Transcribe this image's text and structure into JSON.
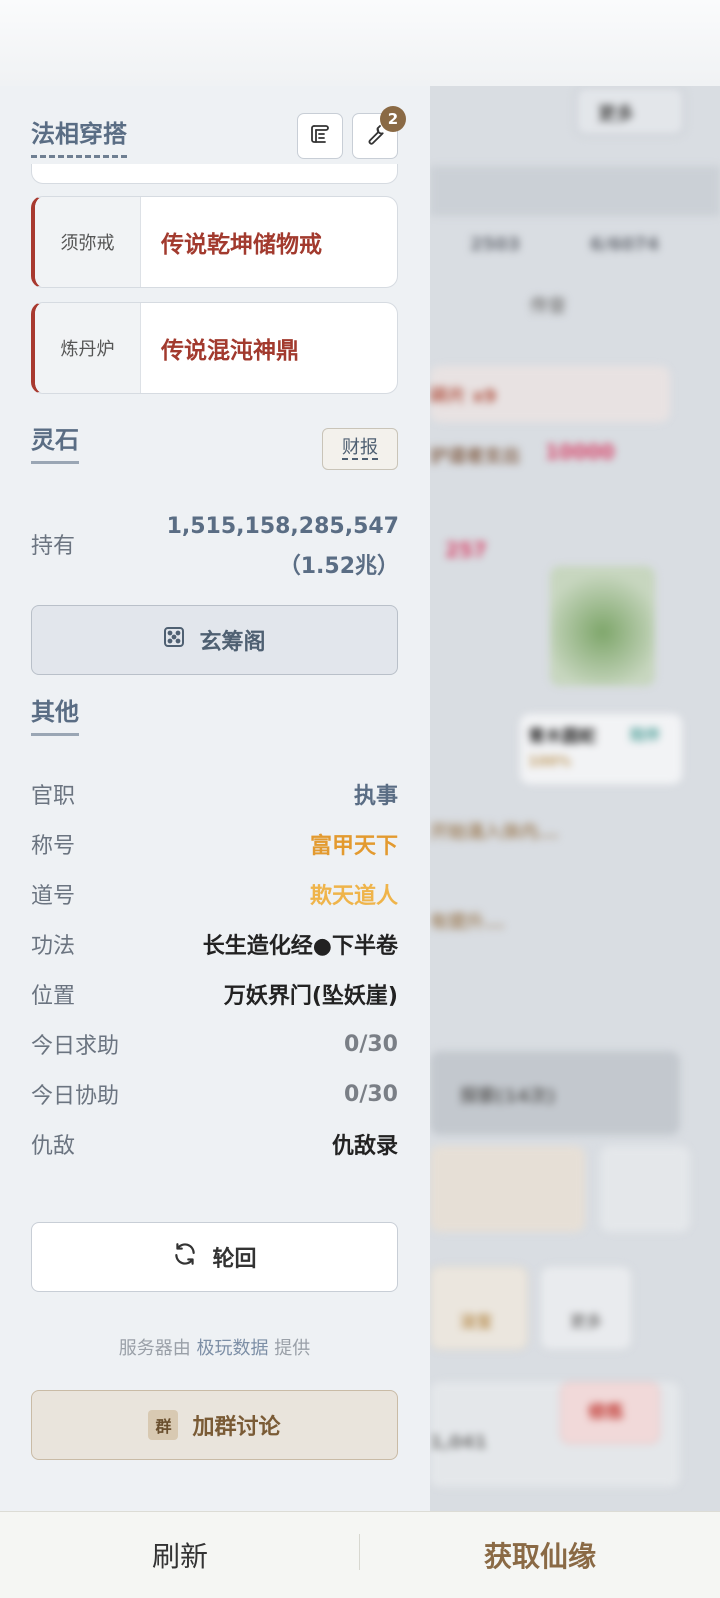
{
  "drawer": {
    "outfit_title": "法相穿搭",
    "badge_count": "2",
    "equipment": [
      {
        "slot": "须弥戒",
        "item": "传说乾坤储物戒"
      },
      {
        "slot": "炼丹炉",
        "item": "传说混沌神鼎"
      }
    ],
    "spirit_stone": {
      "title": "灵石",
      "report_label": "财报",
      "hold_label": "持有",
      "hold_value": "1,515,158,285,547",
      "hold_short": "（1.52兆）",
      "pavilion_label": "玄筹阁"
    },
    "other": {
      "title": "其他",
      "rows": [
        {
          "key": "官职",
          "value": "执事",
          "color": "#5a6d84"
        },
        {
          "key": "称号",
          "value": "富甲天下",
          "color": "#e39a2f"
        },
        {
          "key": "道号",
          "value": "欺天道人",
          "color": "#efb44a"
        },
        {
          "key": "功法",
          "value": "长生造化经●下半卷",
          "color": "#222222"
        },
        {
          "key": "位置",
          "value": "万妖界门(坠妖崖)",
          "color": "#222222"
        },
        {
          "key": "今日求助",
          "value": "0/30",
          "color": "#7a7f86"
        },
        {
          "key": "今日协助",
          "value": "0/30",
          "color": "#7a7f86"
        },
        {
          "key": "仇敌",
          "value": "仇敌录",
          "color": "#222222"
        }
      ]
    },
    "reincarnate_label": "轮回",
    "server_prefix": "服务器由",
    "server_provider": "极玩数据",
    "server_suffix": "提供",
    "group_icon": "群",
    "group_label": "加群讨论"
  },
  "background": {
    "more_label": "更多",
    "stat_a": "2503",
    "stat_b": "6/6074",
    "tab_label": "传音",
    "line1": "碎片 x9",
    "line2_prefix": "护道者支出",
    "line2_value": "10000",
    "line3": "257",
    "creature_name": "青木圆蛇",
    "creature_tag": "陪伴",
    "creature_pct": "100%",
    "progress_line1": "开始涌入体内...",
    "progress_line2": "有提升...",
    "explore_label": "探索(14次)",
    "slot_a": "法宝",
    "slot_b": "更多",
    "bottom_value": "1,041",
    "red_button": "修炼"
  },
  "bottom_bar": {
    "refresh_label": "刷新",
    "fate_label": "获取仙缘"
  },
  "colors": {
    "accent_brown": "#8a6a45",
    "item_red": "#a23a2e",
    "title_slate": "#5a6d84"
  }
}
